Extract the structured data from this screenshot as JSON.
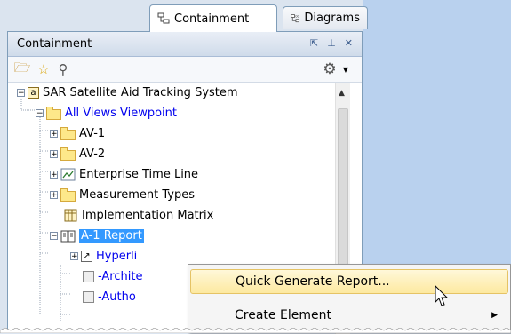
{
  "tabs": [
    {
      "label": "Containment",
      "icon": "containment-icon"
    },
    {
      "label": "Diagrams",
      "icon": "diagrams-icon"
    }
  ],
  "panel": {
    "title": "Containment",
    "title_buttons": [
      "float-icon",
      "pin-icon",
      "close-icon"
    ]
  },
  "toolbar": {
    "icons": [
      "open-folder-icon",
      "star-icon",
      "search-icon",
      "gear-icon"
    ]
  },
  "tree": [
    {
      "label": "SAR Satellite Aid Tracking System",
      "icon": "package-icon"
    },
    {
      "label": "All Views Viewpoint",
      "icon": "folder-icon"
    },
    {
      "label": "AV-1",
      "icon": "folder-icon"
    },
    {
      "label": "AV-2",
      "icon": "folder-icon"
    },
    {
      "label": "Enterprise Time Line",
      "icon": "timeline-icon"
    },
    {
      "label": "Measurement Types",
      "icon": "folder-icon"
    },
    {
      "label": "Implementation Matrix",
      "icon": "matrix-icon"
    },
    {
      "label": "A-1 Report",
      "icon": "report-icon"
    },
    {
      "label": "Hyperli",
      "icon": "hyperlink-icon"
    },
    {
      "label": "-Archite",
      "icon": "document-icon"
    },
    {
      "label": "-Autho",
      "icon": "document-icon"
    }
  ],
  "context_menu": {
    "items": [
      {
        "label": "Quick Generate Report..."
      },
      {
        "label": "Create Element"
      }
    ]
  },
  "colors": {
    "selection": "#3399ff",
    "link": "#0000ee",
    "menu_highlight": "#fde9a0",
    "right_pane": "#b9d1ee"
  }
}
